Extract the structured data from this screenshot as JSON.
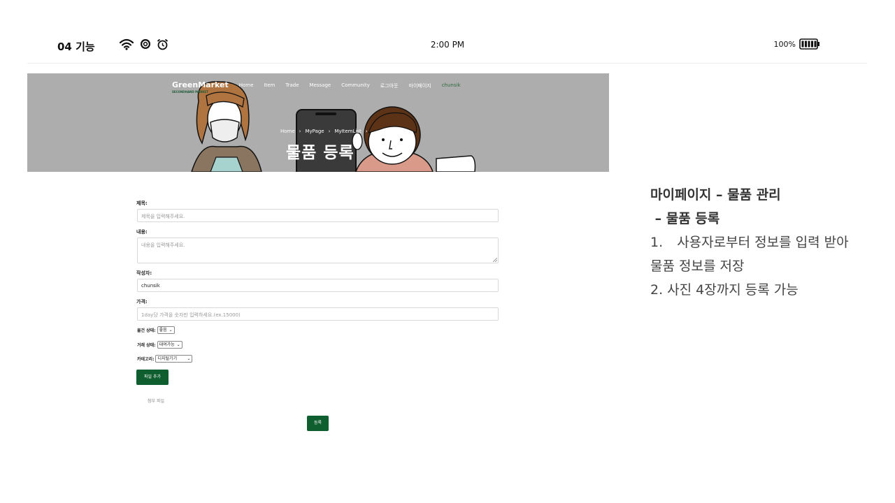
{
  "status_bar": {
    "label": "04 기능",
    "time": "2:00 PM",
    "battery": "100%",
    "icons": [
      "wifi-icon",
      "record-icon",
      "alarm-icon",
      "battery-icon"
    ]
  },
  "site": {
    "brand": "GreenMarket",
    "brand_sub": "SECONDHAND MARKET",
    "nav": [
      "Home",
      "Item",
      "Trade",
      "Message",
      "Community",
      "로그아웃",
      "마이페이지",
      "chunsik"
    ],
    "breadcrumb": [
      "Home",
      "MyPage",
      "MyItemList"
    ],
    "page_title": "물품 등록"
  },
  "form": {
    "title_label": "제목:",
    "title_placeholder": "제목을 입력해주세요.",
    "content_label": "내용:",
    "content_placeholder": "내용을 입력해주세요.",
    "author_label": "작성자:",
    "author_value": "chunsik",
    "price_label": "가격:",
    "price_placeholder": "1day당 가격을 숫자만 입력하세요.(ex.15000)",
    "condition_label": "물건 상태:",
    "condition_value": "좋음",
    "trade_label": "거래 상태:",
    "trade_value": "대여가능",
    "category_label": "카테고리:",
    "category_value": "디지털기기",
    "add_file_button": "파일 추가",
    "attach_label": "첨부 파일",
    "submit_button": "등록"
  },
  "description": {
    "heading": "마이페이지 – 물품 관리",
    "subheading": " – 물품 등록",
    "item1_num": "1.",
    "item1_text": "사용자로부터 정보를 입력 받아",
    "item1_cont": "물품 정보를 저장",
    "item2": "2. 사진 4장까지 등록 가능"
  },
  "colors": {
    "accent_green": "#0f5e2f",
    "hero_gray": "#adadad"
  }
}
